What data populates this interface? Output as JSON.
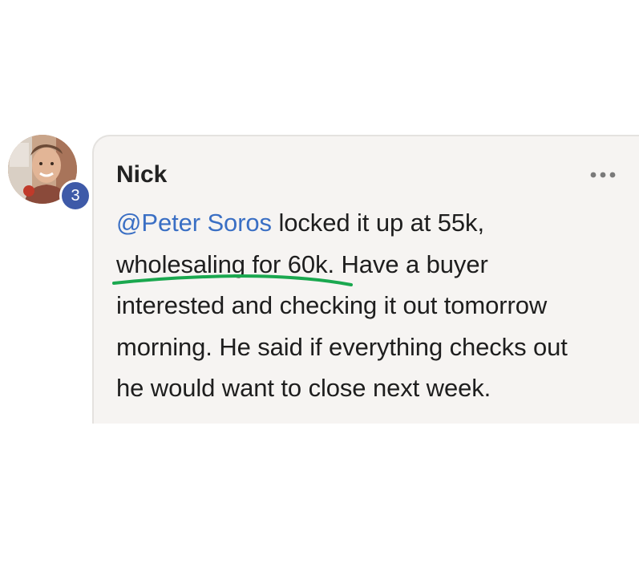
{
  "comment": {
    "author": "Nick",
    "avatar_badge": "3",
    "mention": "@Peter Soros",
    "lines": [
      " locked it up at 55k,",
      "wholesaling for 60k",
      ". Have a buyer",
      "interested and checking it out tomorrow",
      "morning. He said if everything checks out",
      "he would want to close next week."
    ],
    "more_icon": "more-horizontal-icon"
  },
  "colors": {
    "mention": "#3a6fc4",
    "badge": "#3e5aa8",
    "annotation_underline": "#1aa84f",
    "bubble_background": "#f6f4f2"
  }
}
